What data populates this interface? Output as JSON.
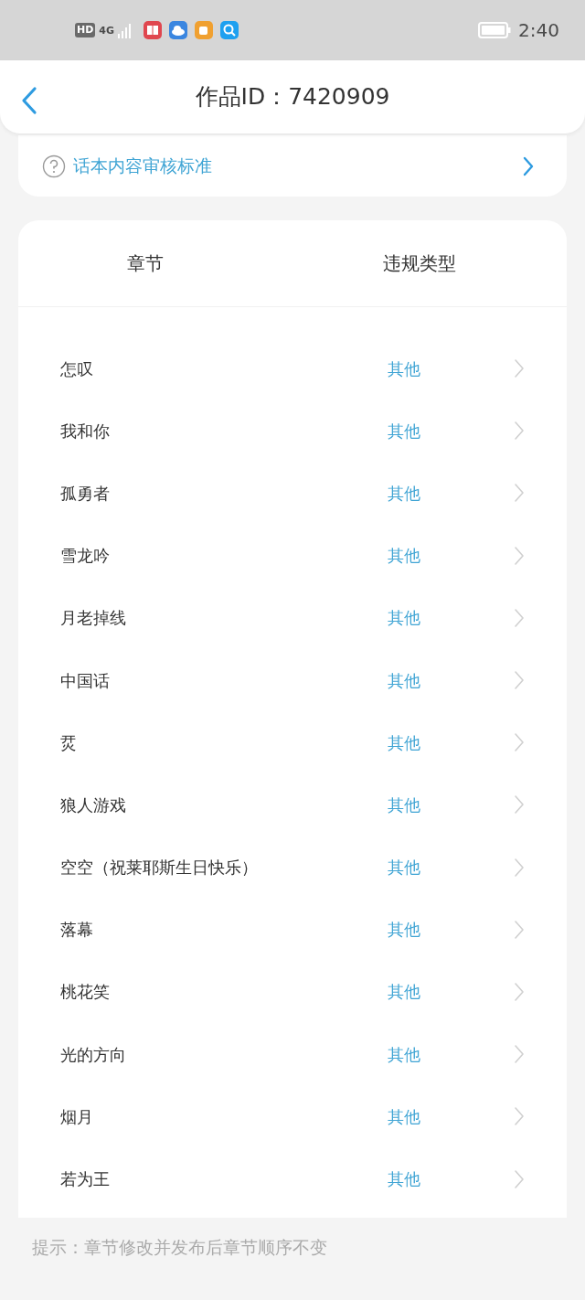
{
  "status_bar": {
    "hd": "HD",
    "network": "4G",
    "time": "2:40"
  },
  "header": {
    "title": "作品ID：7420909"
  },
  "guide_link": {
    "label": "话本内容审核标准"
  },
  "table": {
    "columns": [
      "章节",
      "违规类型"
    ],
    "rows": [
      {
        "chapter": "怎叹",
        "type": "其他"
      },
      {
        "chapter": "我和你",
        "type": "其他"
      },
      {
        "chapter": "孤勇者",
        "type": "其他"
      },
      {
        "chapter": "雪龙吟",
        "type": "其他"
      },
      {
        "chapter": "月老掉线",
        "type": "其他"
      },
      {
        "chapter": "中国话",
        "type": "其他"
      },
      {
        "chapter": "烎",
        "type": "其他"
      },
      {
        "chapter": "狼人游戏",
        "type": "其他"
      },
      {
        "chapter": "空空（祝莱耶斯生日快乐）",
        "type": "其他"
      },
      {
        "chapter": "落幕",
        "type": "其他"
      },
      {
        "chapter": "桃花笑",
        "type": "其他"
      },
      {
        "chapter": "光的方向",
        "type": "其他"
      },
      {
        "chapter": "烟月",
        "type": "其他"
      },
      {
        "chapter": "若为王",
        "type": "其他"
      }
    ]
  },
  "tip": "提示：章节修改并发布后章节顺序不变"
}
